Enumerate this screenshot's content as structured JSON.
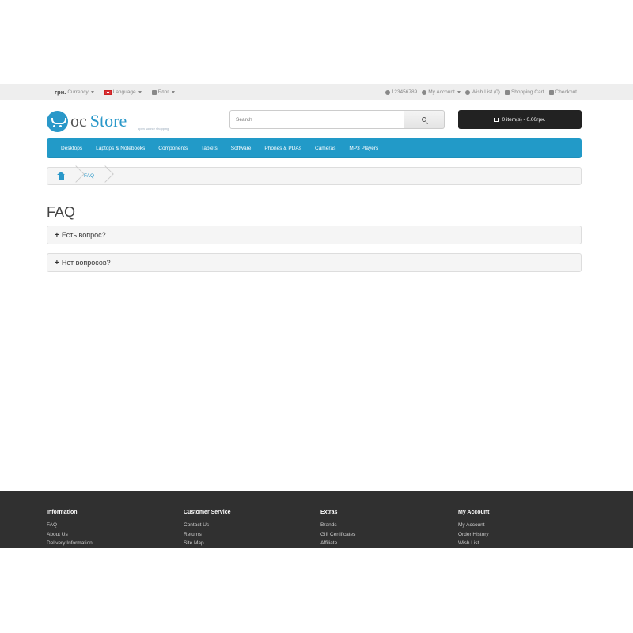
{
  "top_bar": {
    "currency_symbol": "грн.",
    "currency_label": "Currency",
    "language_label": "Language",
    "blog_label": "Блог",
    "phone": "123456789",
    "my_account": "My Account",
    "wish_list": "Wish List (0)",
    "shopping_cart": "Shopping Cart",
    "checkout": "Checkout"
  },
  "logo": {
    "oc": "oc",
    "store": "Store",
    "tagline": "open source shopping"
  },
  "search": {
    "placeholder": "Search"
  },
  "cart": {
    "label": "0 item(s) - 0.00грн."
  },
  "menu": {
    "items": [
      "Desktops",
      "Laptops & Notebooks",
      "Components",
      "Tablets",
      "Software",
      "Phones & PDAs",
      "Cameras",
      "MP3 Players"
    ]
  },
  "breadcrumb": {
    "current": "FAQ"
  },
  "page": {
    "title": "FAQ"
  },
  "faq": {
    "items": [
      "Есть вопрос?",
      "Нет вопросов?"
    ]
  },
  "footer": {
    "columns": [
      {
        "heading": "Information",
        "links": [
          "FAQ",
          "About Us",
          "Delivery Information"
        ]
      },
      {
        "heading": "Customer Service",
        "links": [
          "Contact Us",
          "Returns",
          "Site Map"
        ]
      },
      {
        "heading": "Extras",
        "links": [
          "Brands",
          "Gift Certificates",
          "Affiliate"
        ]
      },
      {
        "heading": "My Account",
        "links": [
          "My Account",
          "Order History",
          "Wish List"
        ]
      }
    ]
  },
  "colors": {
    "accent": "#229ac8",
    "topbar": "#eeeeee",
    "cart_button": "#222222",
    "footer": "#303030"
  }
}
